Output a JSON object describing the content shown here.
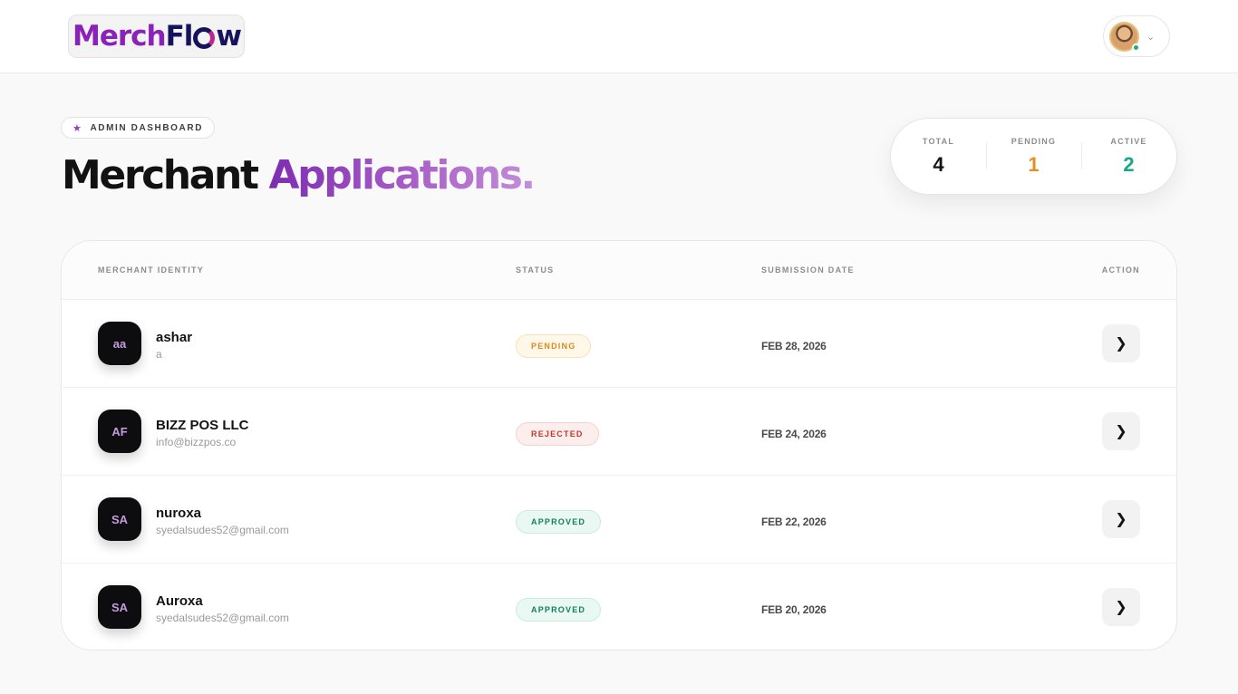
{
  "header": {
    "logo_part1": "Merch",
    "logo_part2a": "Fl",
    "logo_part2b": "w",
    "profile_chevron_icon": "chevron-down-icon"
  },
  "hero": {
    "badge_label": "ADMIN DASHBOARD",
    "title_dark": "Merchant",
    "title_accent": "Applications."
  },
  "stats": {
    "total_label": "TOTAL",
    "total_value": "4",
    "pending_label": "PENDING",
    "pending_value": "1",
    "active_label": "ACTIVE",
    "active_value": "2"
  },
  "table": {
    "columns": [
      "MERCHANT IDENTITY",
      "STATUS",
      "SUBMISSION DATE",
      "ACTION"
    ],
    "rows": [
      {
        "initials": "aa",
        "name": "ashar",
        "email": "a",
        "status": "PENDING",
        "date": "FEB 28, 2026"
      },
      {
        "initials": "AF",
        "name": "BIZZ POS LLC",
        "email": "info@bizzpos.co",
        "status": "REJECTED",
        "date": "FEB 24, 2026"
      },
      {
        "initials": "SA",
        "name": "nuroxa",
        "email": "syedalsudes52@gmail.com",
        "status": "APPROVED",
        "date": "FEB 22, 2026"
      },
      {
        "initials": "SA",
        "name": "Auroxa",
        "email": "syedalsudes52@gmail.com",
        "status": "APPROVED",
        "date": "FEB 20, 2026"
      }
    ]
  },
  "colors": {
    "brand_purple": "#8a22b8",
    "pending": "#e58f1f",
    "active": "#15a886",
    "rejected": "#c0392b"
  }
}
